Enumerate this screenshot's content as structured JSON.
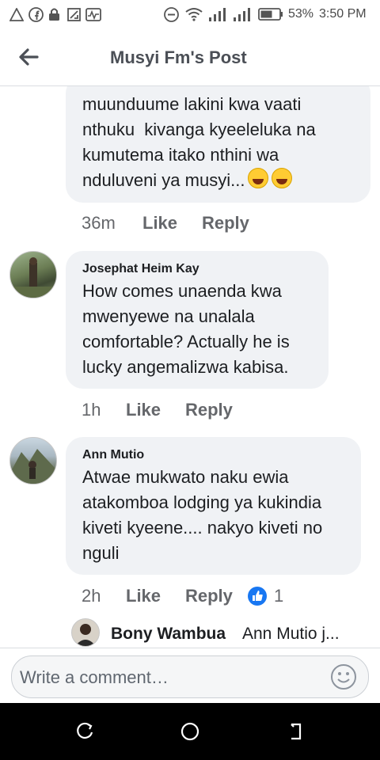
{
  "status_bar": {
    "battery": "53%",
    "time": "3:50 PM",
    "icons": [
      "warning-icon",
      "facebook-icon",
      "lock-icon",
      "screenshot-icon",
      "activity-icon",
      "dnd-icon",
      "wifi-icon",
      "signal-icon",
      "signal-icon",
      "battery-icon"
    ]
  },
  "header": {
    "title": "Musyi Fm's Post",
    "back_icon": "arrow-left-icon"
  },
  "comments": [
    {
      "text": "muunduume lakini kwa vaati\nnthuku  kivanga kyeeleluka na\nkumutema itako nthini wa\nnduluveni ya musyi...",
      "emojis": [
        "rofl-emoji",
        "rofl-emoji"
      ],
      "time": "36m",
      "like": "Like",
      "reply": "Reply"
    },
    {
      "author": "Josephat Heim Kay",
      "text": "How comes unaenda kwa\nmwenyewe na unalala\ncomfortable? Actually he is\nlucky angemalizwa kabisa.",
      "time": "1h",
      "like": "Like",
      "reply": "Reply"
    },
    {
      "author": "Ann Mutio",
      "text": "Atwae mukwato naku ewia\natakomboa lodging ya kukindia\nkiveti kyeene.... nakyo kiveti no\nnguli",
      "time": "2h",
      "like": "Like",
      "reply": "Reply",
      "reaction_count": "1"
    }
  ],
  "reply_preview": {
    "author": "Bony Wambua",
    "text": "Ann Mutio j..."
  },
  "composer": {
    "placeholder": "Write a comment…",
    "icon": "smiley-icon"
  },
  "nav": {
    "icons": [
      "recent-apps-icon",
      "home-icon",
      "back-icon"
    ]
  },
  "colors": {
    "bubble": "#f0f2f5",
    "like_blue": "#1877f2",
    "meta": "#65676b",
    "nav": "#000000"
  }
}
